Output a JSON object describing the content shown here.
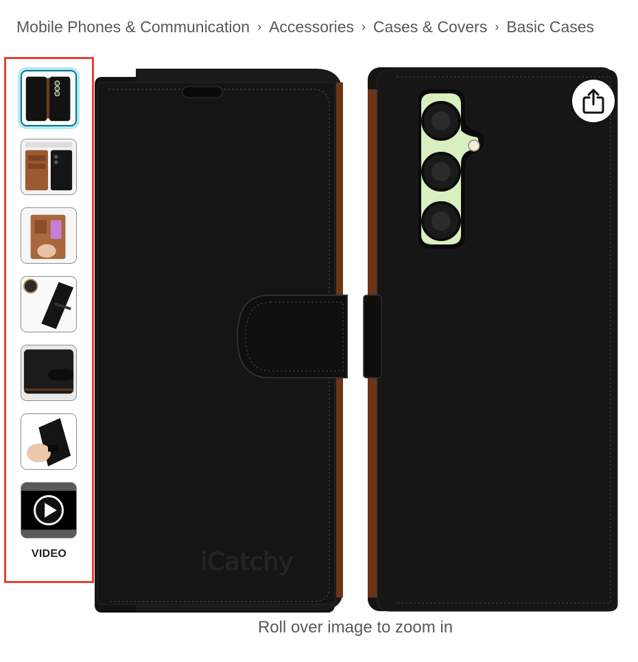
{
  "breadcrumb": {
    "items": [
      "Mobile Phones & Communication",
      "Accessories",
      "Cases & Covers",
      "Basic Cases"
    ],
    "separator": "›"
  },
  "gallery": {
    "thumbnails": [
      {
        "kind": "image",
        "subject": "black wallet case front and back",
        "selected": true
      },
      {
        "kind": "image",
        "subject": "case open showing brown card slots"
      },
      {
        "kind": "image",
        "subject": "hand holding open case with cards"
      },
      {
        "kind": "image",
        "subject": "case at angle with camera cutout"
      },
      {
        "kind": "image",
        "subject": "closed case with magnetic strap"
      },
      {
        "kind": "image",
        "subject": "hand holding closed case"
      },
      {
        "kind": "video",
        "subject": "product video"
      }
    ],
    "video_label": "VIDEO",
    "selection_color": "#007185",
    "highlight_border_color": "#e4432f"
  },
  "main_image": {
    "brand_emboss": "iCatchy",
    "case_color": "#151515",
    "inner_color": "#7a3a1c"
  },
  "share": {
    "icon": "share-icon"
  },
  "zoom_hint": "Roll over image to zoom in"
}
